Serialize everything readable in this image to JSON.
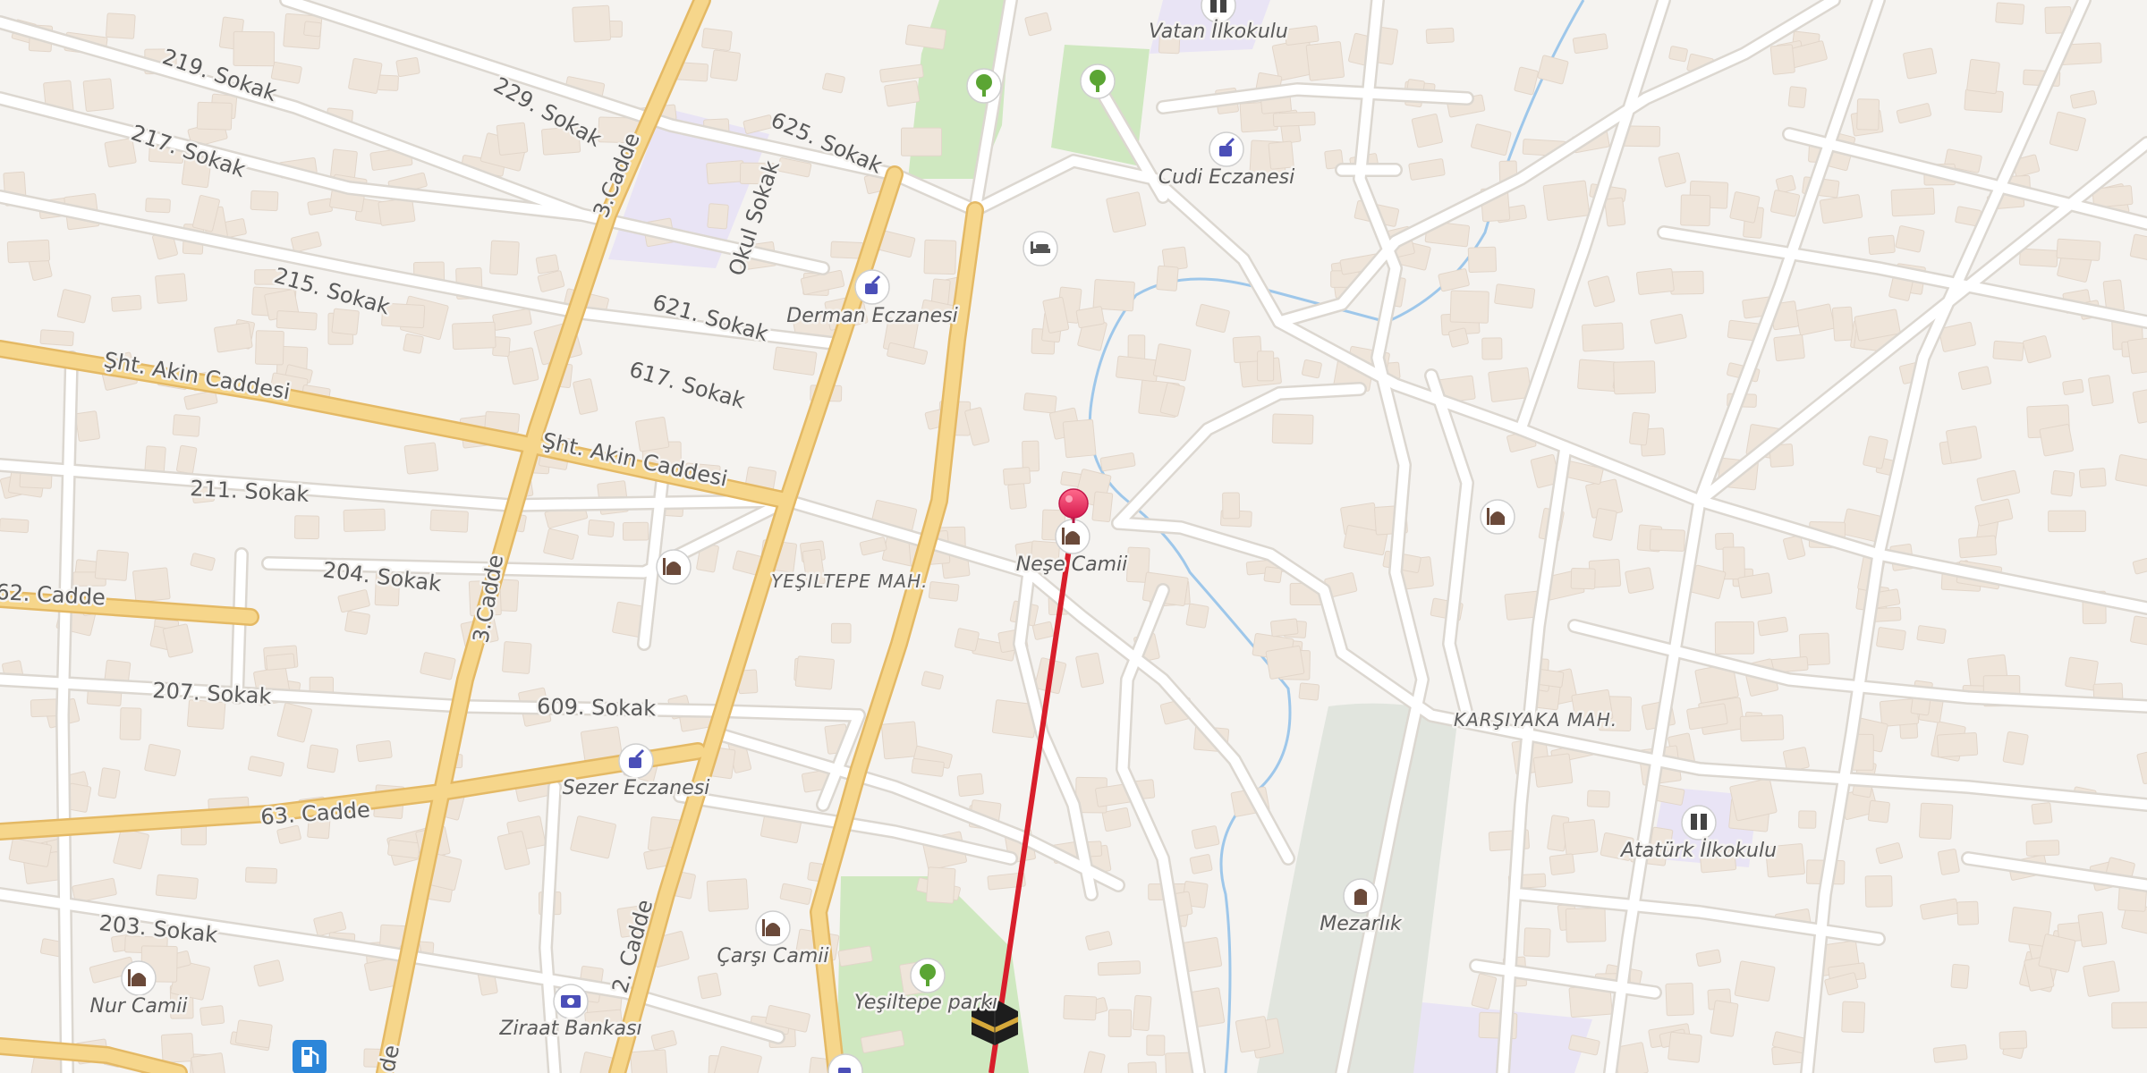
{
  "map": {
    "streets": {
      "s219": "219. Sokak",
      "s229": "229. Sokak",
      "s217": "217. Sokak",
      "s625": "625. Sokak",
      "cadde3_top": "3.Cadde",
      "okul": "Okul Sokak",
      "s215": "215. Sokak",
      "s621": "621. Sokak",
      "akin1": "Şht. Akin Caddesi",
      "akin2": "Şht. Akin Caddesi",
      "s617": "617. Sokak",
      "s211": "211. Sokak",
      "s204": "204. Sokak",
      "c62": "62. Cadde",
      "cadde3_mid": "3.Cadde",
      "s207": "207. Sokak",
      "s609": "609. Sokak",
      "c63": "63. Cadde",
      "s203": "203. Sokak",
      "cadde2": "2. Cadde",
      "cadde_bottom": "de"
    },
    "districts": {
      "yesiltepe": "YEŞILTEPE MAH.",
      "karsiyaka": "KARŞIYAKA MAH."
    },
    "pois": {
      "vatan": "Vatan İlkokulu",
      "cudi": "Cudi Eczanesi",
      "derman": "Derman Eczanesi",
      "nese": "Neşe Camii",
      "sezer": "Sezer Eczanesi",
      "carsi": "Çarşı Camii",
      "yesiltepe_park": "Yeşiltepe parkı",
      "ziraat": "Ziraat Bankası",
      "nur": "Nur Camii",
      "mezarlik": "Mezarlık",
      "ataturk": "Atatürk İlkokulu"
    },
    "icons": [
      "park-tree-icon",
      "pharmacy-icon",
      "school-icon",
      "hotel-icon",
      "mosque-icon",
      "bank-icon",
      "cemetery-icon",
      "fuel-station-icon",
      "kaaba-icon",
      "location-pin-icon"
    ],
    "colors": {
      "background": "#f5f3f0",
      "main_road": "#f6d68b",
      "main_road_casing": "#e4b965",
      "street": "#ffffff",
      "street_casing": "#dcd7d0",
      "building": "#efe5da",
      "park": "#cfe8c0",
      "school_area": "#e9e4f5",
      "cemetery_area": "#e1e5de",
      "water": "#9ec7ea",
      "qibla_line": "#d81e2b",
      "pin": "#e4245b"
    }
  }
}
